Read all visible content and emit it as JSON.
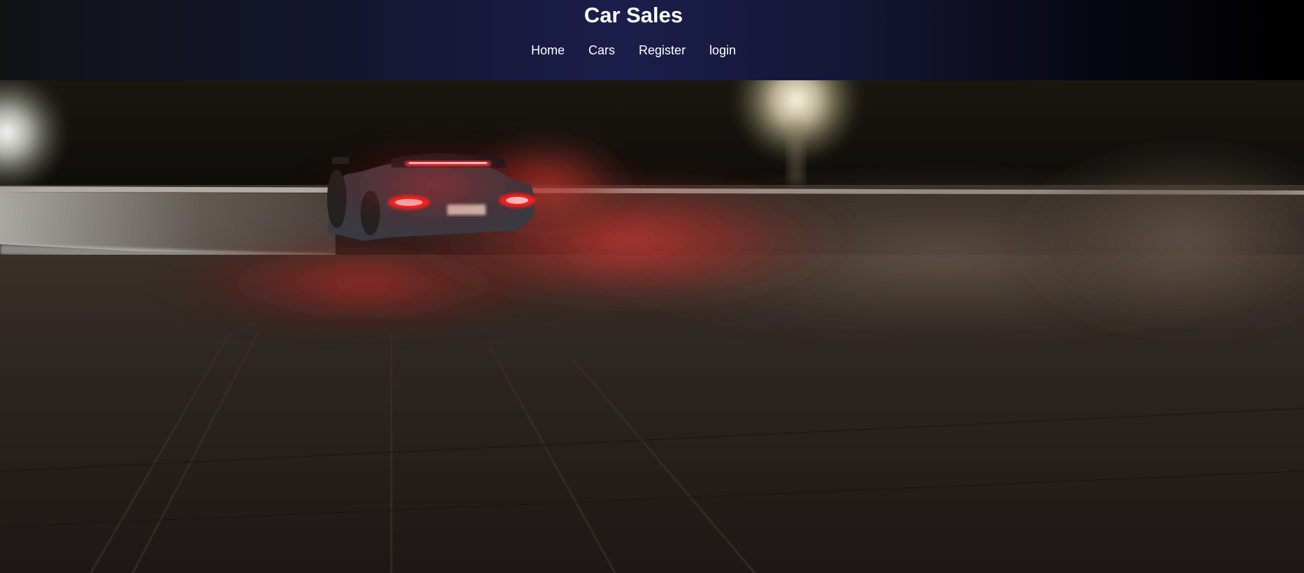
{
  "header": {
    "title": "Car Sales",
    "nav": [
      {
        "label": "Home"
      },
      {
        "label": "Cars"
      },
      {
        "label": "Register"
      },
      {
        "label": "login"
      }
    ]
  },
  "hero": {
    "description_icon": "drifting-car-photo"
  },
  "colors": {
    "header_mid": "#1b1e4a",
    "header_left": "#111214",
    "header_right": "#000000",
    "nav_text": "#ffffff",
    "taillight": "#ff1a1a"
  }
}
